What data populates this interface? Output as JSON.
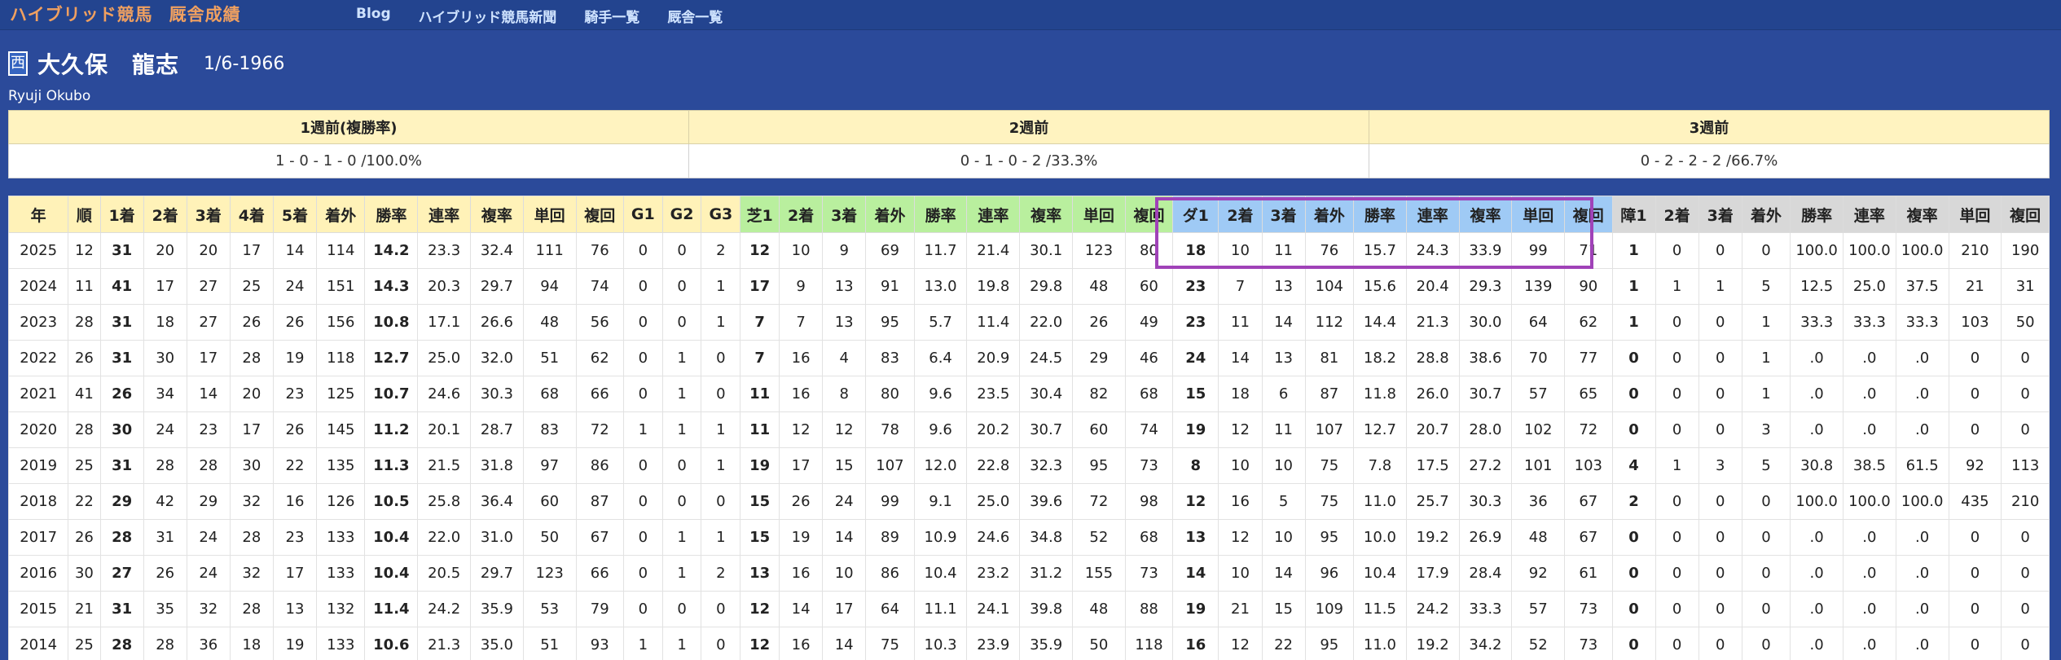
{
  "nav": {
    "brand": "ハイブリッド競馬",
    "section": "厩舎成績",
    "links": [
      "Blog",
      "ハイブリッド競馬新聞",
      "騎手一覧",
      "厩舎一覧"
    ]
  },
  "jockey": {
    "region": "西",
    "name": "大久保　龍志",
    "birth": "1/6-1966",
    "name_en": "Ryuji Okubo"
  },
  "weekly": {
    "headers": [
      "1週前(複勝率)",
      "2週前",
      "3週前"
    ],
    "values": [
      "1 - 0 - 1 - 0 /100.0%",
      "0 - 1 - 0 - 2 /33.3%",
      "0 - 2 - 2 - 2 /66.7%"
    ]
  },
  "colors": {
    "page_bg": "#2b4a9a",
    "nav_bg": "#23448f",
    "brand": "#f0a060",
    "nav_link": "#cfe3ff",
    "header_all": "#fff2b8",
    "header_turf": "#b9ef9e",
    "header_dirt": "#9fcaf5",
    "header_jump": "#d8d8d8",
    "highlight_box": "#a042b8"
  },
  "stats": {
    "headers": [
      {
        "label": "年",
        "group": "all"
      },
      {
        "label": "順",
        "group": "all"
      },
      {
        "label": "1着",
        "group": "all"
      },
      {
        "label": "2着",
        "group": "all"
      },
      {
        "label": "3着",
        "group": "all"
      },
      {
        "label": "4着",
        "group": "all"
      },
      {
        "label": "5着",
        "group": "all"
      },
      {
        "label": "着外",
        "group": "all"
      },
      {
        "label": "勝率",
        "group": "all"
      },
      {
        "label": "連率",
        "group": "all"
      },
      {
        "label": "複率",
        "group": "all"
      },
      {
        "label": "単回",
        "group": "all"
      },
      {
        "label": "複回",
        "group": "all"
      },
      {
        "label": "G1",
        "group": "all"
      },
      {
        "label": "G2",
        "group": "all"
      },
      {
        "label": "G3",
        "group": "all"
      },
      {
        "label": "芝1",
        "group": "turf"
      },
      {
        "label": "2着",
        "group": "turf"
      },
      {
        "label": "3着",
        "group": "turf"
      },
      {
        "label": "着外",
        "group": "turf"
      },
      {
        "label": "勝率",
        "group": "turf"
      },
      {
        "label": "連率",
        "group": "turf"
      },
      {
        "label": "複率",
        "group": "turf"
      },
      {
        "label": "単回",
        "group": "turf"
      },
      {
        "label": "複回",
        "group": "turf"
      },
      {
        "label": "ダ1",
        "group": "dirt"
      },
      {
        "label": "2着",
        "group": "dirt"
      },
      {
        "label": "3着",
        "group": "dirt"
      },
      {
        "label": "着外",
        "group": "dirt"
      },
      {
        "label": "勝率",
        "group": "dirt"
      },
      {
        "label": "連率",
        "group": "dirt"
      },
      {
        "label": "複率",
        "group": "dirt"
      },
      {
        "label": "単回",
        "group": "dirt"
      },
      {
        "label": "複回",
        "group": "dirt"
      },
      {
        "label": "障1",
        "group": "jump"
      },
      {
        "label": "2着",
        "group": "jump"
      },
      {
        "label": "3着",
        "group": "jump"
      },
      {
        "label": "着外",
        "group": "jump"
      },
      {
        "label": "勝率",
        "group": "jump"
      },
      {
        "label": "連率",
        "group": "jump"
      },
      {
        "label": "複率",
        "group": "jump"
      },
      {
        "label": "単回",
        "group": "jump"
      },
      {
        "label": "複回",
        "group": "jump"
      }
    ],
    "bold_columns": [
      2,
      8,
      16,
      25,
      34
    ],
    "highlighted_block": "dirt",
    "rows": [
      [
        "2025",
        "12",
        "31",
        "20",
        "20",
        "17",
        "14",
        "114",
        "14.2",
        "23.3",
        "32.4",
        "111",
        "76",
        "0",
        "0",
        "2",
        "12",
        "10",
        "9",
        "69",
        "11.7",
        "21.4",
        "30.1",
        "123",
        "80",
        "18",
        "10",
        "11",
        "76",
        "15.7",
        "24.3",
        "33.9",
        "99",
        "71",
        "1",
        "0",
        "0",
        "0",
        "100.0",
        "100.0",
        "100.0",
        "210",
        "190"
      ],
      [
        "2024",
        "11",
        "41",
        "17",
        "27",
        "25",
        "24",
        "151",
        "14.3",
        "20.3",
        "29.7",
        "94",
        "74",
        "0",
        "0",
        "1",
        "17",
        "9",
        "13",
        "91",
        "13.0",
        "19.8",
        "29.8",
        "48",
        "60",
        "23",
        "7",
        "13",
        "104",
        "15.6",
        "20.4",
        "29.3",
        "139",
        "90",
        "1",
        "1",
        "1",
        "5",
        "12.5",
        "25.0",
        "37.5",
        "21",
        "31"
      ],
      [
        "2023",
        "28",
        "31",
        "18",
        "27",
        "26",
        "26",
        "156",
        "10.8",
        "17.1",
        "26.6",
        "48",
        "56",
        "0",
        "0",
        "1",
        "7",
        "7",
        "13",
        "95",
        "5.7",
        "11.4",
        "22.0",
        "26",
        "49",
        "23",
        "11",
        "14",
        "112",
        "14.4",
        "21.3",
        "30.0",
        "64",
        "62",
        "1",
        "0",
        "0",
        "1",
        "33.3",
        "33.3",
        "33.3",
        "103",
        "50"
      ],
      [
        "2022",
        "26",
        "31",
        "30",
        "17",
        "28",
        "19",
        "118",
        "12.7",
        "25.0",
        "32.0",
        "51",
        "62",
        "0",
        "1",
        "0",
        "7",
        "16",
        "4",
        "83",
        "6.4",
        "20.9",
        "24.5",
        "29",
        "46",
        "24",
        "14",
        "13",
        "81",
        "18.2",
        "28.8",
        "38.6",
        "70",
        "77",
        "0",
        "0",
        "0",
        "1",
        ".0",
        ".0",
        ".0",
        "0",
        "0"
      ],
      [
        "2021",
        "41",
        "26",
        "34",
        "14",
        "20",
        "23",
        "125",
        "10.7",
        "24.6",
        "30.3",
        "68",
        "66",
        "0",
        "1",
        "0",
        "11",
        "16",
        "8",
        "80",
        "9.6",
        "23.5",
        "30.4",
        "82",
        "68",
        "15",
        "18",
        "6",
        "87",
        "11.8",
        "26.0",
        "30.7",
        "57",
        "65",
        "0",
        "0",
        "0",
        "1",
        ".0",
        ".0",
        ".0",
        "0",
        "0"
      ],
      [
        "2020",
        "28",
        "30",
        "24",
        "23",
        "17",
        "26",
        "145",
        "11.2",
        "20.1",
        "28.7",
        "83",
        "72",
        "1",
        "1",
        "1",
        "11",
        "12",
        "12",
        "78",
        "9.6",
        "20.2",
        "30.7",
        "60",
        "74",
        "19",
        "12",
        "11",
        "107",
        "12.7",
        "20.7",
        "28.0",
        "102",
        "72",
        "0",
        "0",
        "0",
        "3",
        ".0",
        ".0",
        ".0",
        "0",
        "0"
      ],
      [
        "2019",
        "25",
        "31",
        "28",
        "28",
        "30",
        "22",
        "135",
        "11.3",
        "21.5",
        "31.8",
        "97",
        "86",
        "0",
        "0",
        "1",
        "19",
        "17",
        "15",
        "107",
        "12.0",
        "22.8",
        "32.3",
        "95",
        "73",
        "8",
        "10",
        "10",
        "75",
        "7.8",
        "17.5",
        "27.2",
        "101",
        "103",
        "4",
        "1",
        "3",
        "5",
        "30.8",
        "38.5",
        "61.5",
        "92",
        "113"
      ],
      [
        "2018",
        "22",
        "29",
        "42",
        "29",
        "32",
        "16",
        "126",
        "10.5",
        "25.8",
        "36.4",
        "60",
        "87",
        "0",
        "0",
        "0",
        "15",
        "26",
        "24",
        "99",
        "9.1",
        "25.0",
        "39.6",
        "72",
        "98",
        "12",
        "16",
        "5",
        "75",
        "11.0",
        "25.7",
        "30.3",
        "36",
        "67",
        "2",
        "0",
        "0",
        "0",
        "100.0",
        "100.0",
        "100.0",
        "435",
        "210"
      ],
      [
        "2017",
        "26",
        "28",
        "31",
        "24",
        "28",
        "23",
        "133",
        "10.4",
        "22.0",
        "31.0",
        "50",
        "67",
        "0",
        "1",
        "1",
        "15",
        "19",
        "14",
        "89",
        "10.9",
        "24.6",
        "34.8",
        "52",
        "68",
        "13",
        "12",
        "10",
        "95",
        "10.0",
        "19.2",
        "26.9",
        "48",
        "67",
        "0",
        "0",
        "0",
        "0",
        ".0",
        ".0",
        ".0",
        "0",
        "0"
      ],
      [
        "2016",
        "30",
        "27",
        "26",
        "24",
        "32",
        "17",
        "133",
        "10.4",
        "20.5",
        "29.7",
        "123",
        "66",
        "0",
        "1",
        "2",
        "13",
        "16",
        "10",
        "86",
        "10.4",
        "23.2",
        "31.2",
        "155",
        "73",
        "14",
        "10",
        "14",
        "96",
        "10.4",
        "17.9",
        "28.4",
        "92",
        "61",
        "0",
        "0",
        "0",
        "0",
        ".0",
        ".0",
        ".0",
        "0",
        "0"
      ],
      [
        "2015",
        "21",
        "31",
        "35",
        "32",
        "28",
        "13",
        "132",
        "11.4",
        "24.2",
        "35.9",
        "53",
        "79",
        "0",
        "0",
        "0",
        "12",
        "14",
        "17",
        "64",
        "11.1",
        "24.1",
        "39.8",
        "48",
        "88",
        "19",
        "21",
        "15",
        "109",
        "11.5",
        "24.2",
        "33.3",
        "57",
        "73",
        "0",
        "0",
        "0",
        "0",
        ".0",
        ".0",
        ".0",
        "0",
        "0"
      ],
      [
        "2014",
        "25",
        "28",
        "28",
        "36",
        "18",
        "19",
        "133",
        "10.6",
        "21.3",
        "35.0",
        "51",
        "93",
        "1",
        "1",
        "0",
        "12",
        "16",
        "14",
        "75",
        "10.3",
        "23.9",
        "35.9",
        "50",
        "118",
        "16",
        "12",
        "22",
        "95",
        "11.0",
        "19.2",
        "34.2",
        "52",
        "73",
        "0",
        "0",
        "0",
        "0",
        ".0",
        ".0",
        ".0",
        "0",
        "0"
      ]
    ]
  }
}
